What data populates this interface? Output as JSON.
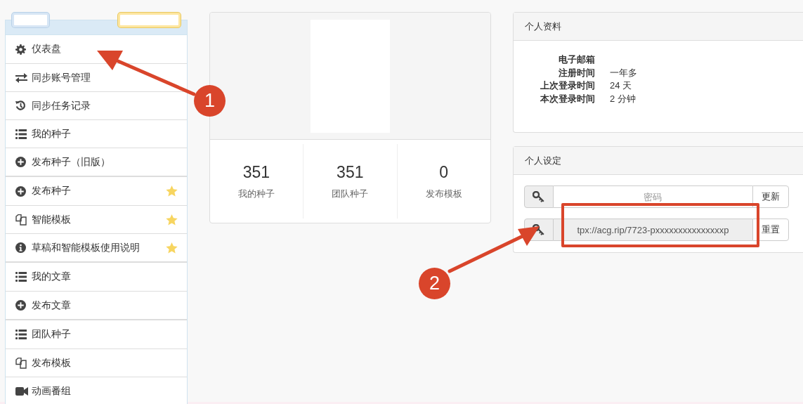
{
  "sidebar": {
    "groups": [
      {
        "items": [
          {
            "kind": "gear",
            "label": "仪表盘",
            "starred": false
          },
          {
            "kind": "swap",
            "label": "同步账号管理",
            "starred": false
          },
          {
            "kind": "history",
            "label": "同步任务记录",
            "starred": false
          },
          {
            "kind": "list",
            "label": "我的种子",
            "starred": false
          },
          {
            "kind": "plus",
            "label": "发布种子（旧版）",
            "starred": false
          }
        ]
      },
      {
        "items": [
          {
            "kind": "plus",
            "label": "发布种子",
            "starred": true
          },
          {
            "kind": "copy",
            "label": "智能模板",
            "starred": true
          },
          {
            "kind": "info",
            "label": "草稿和智能模板使用说明",
            "starred": true
          }
        ]
      },
      {
        "items": [
          {
            "kind": "list",
            "label": "我的文章",
            "starred": false
          },
          {
            "kind": "plus",
            "label": "发布文章",
            "starred": false
          }
        ]
      },
      {
        "items": [
          {
            "kind": "list",
            "label": "团队种子",
            "starred": false
          },
          {
            "kind": "copy",
            "label": "发布模板",
            "starred": false
          },
          {
            "kind": "video",
            "label": "动画番组",
            "starred": false
          }
        ]
      }
    ]
  },
  "stats": [
    {
      "value": "351",
      "label": "我的种子"
    },
    {
      "value": "351",
      "label": "团队种子"
    },
    {
      "value": "0",
      "label": "发布模板"
    }
  ],
  "profile": {
    "title": "个人资料",
    "fields": [
      {
        "label": "电子邮箱"
      },
      {
        "label": "注册时间",
        "value": "一年多"
      },
      {
        "label": "上次登录时间",
        "value": "24 天"
      },
      {
        "label": "本次登录时间",
        "value": "2 分钟"
      }
    ]
  },
  "settings": {
    "title": "个人设定",
    "rows": [
      {
        "placeholder": "密码",
        "readonly": false,
        "button": "更新"
      },
      {
        "value": "tpx://acg.rip/7723-pxxxxxxxxxxxxxxxp",
        "readonly": true,
        "button": "重置"
      }
    ]
  },
  "annotations": [
    {
      "number": "1"
    },
    {
      "number": "2"
    }
  ]
}
